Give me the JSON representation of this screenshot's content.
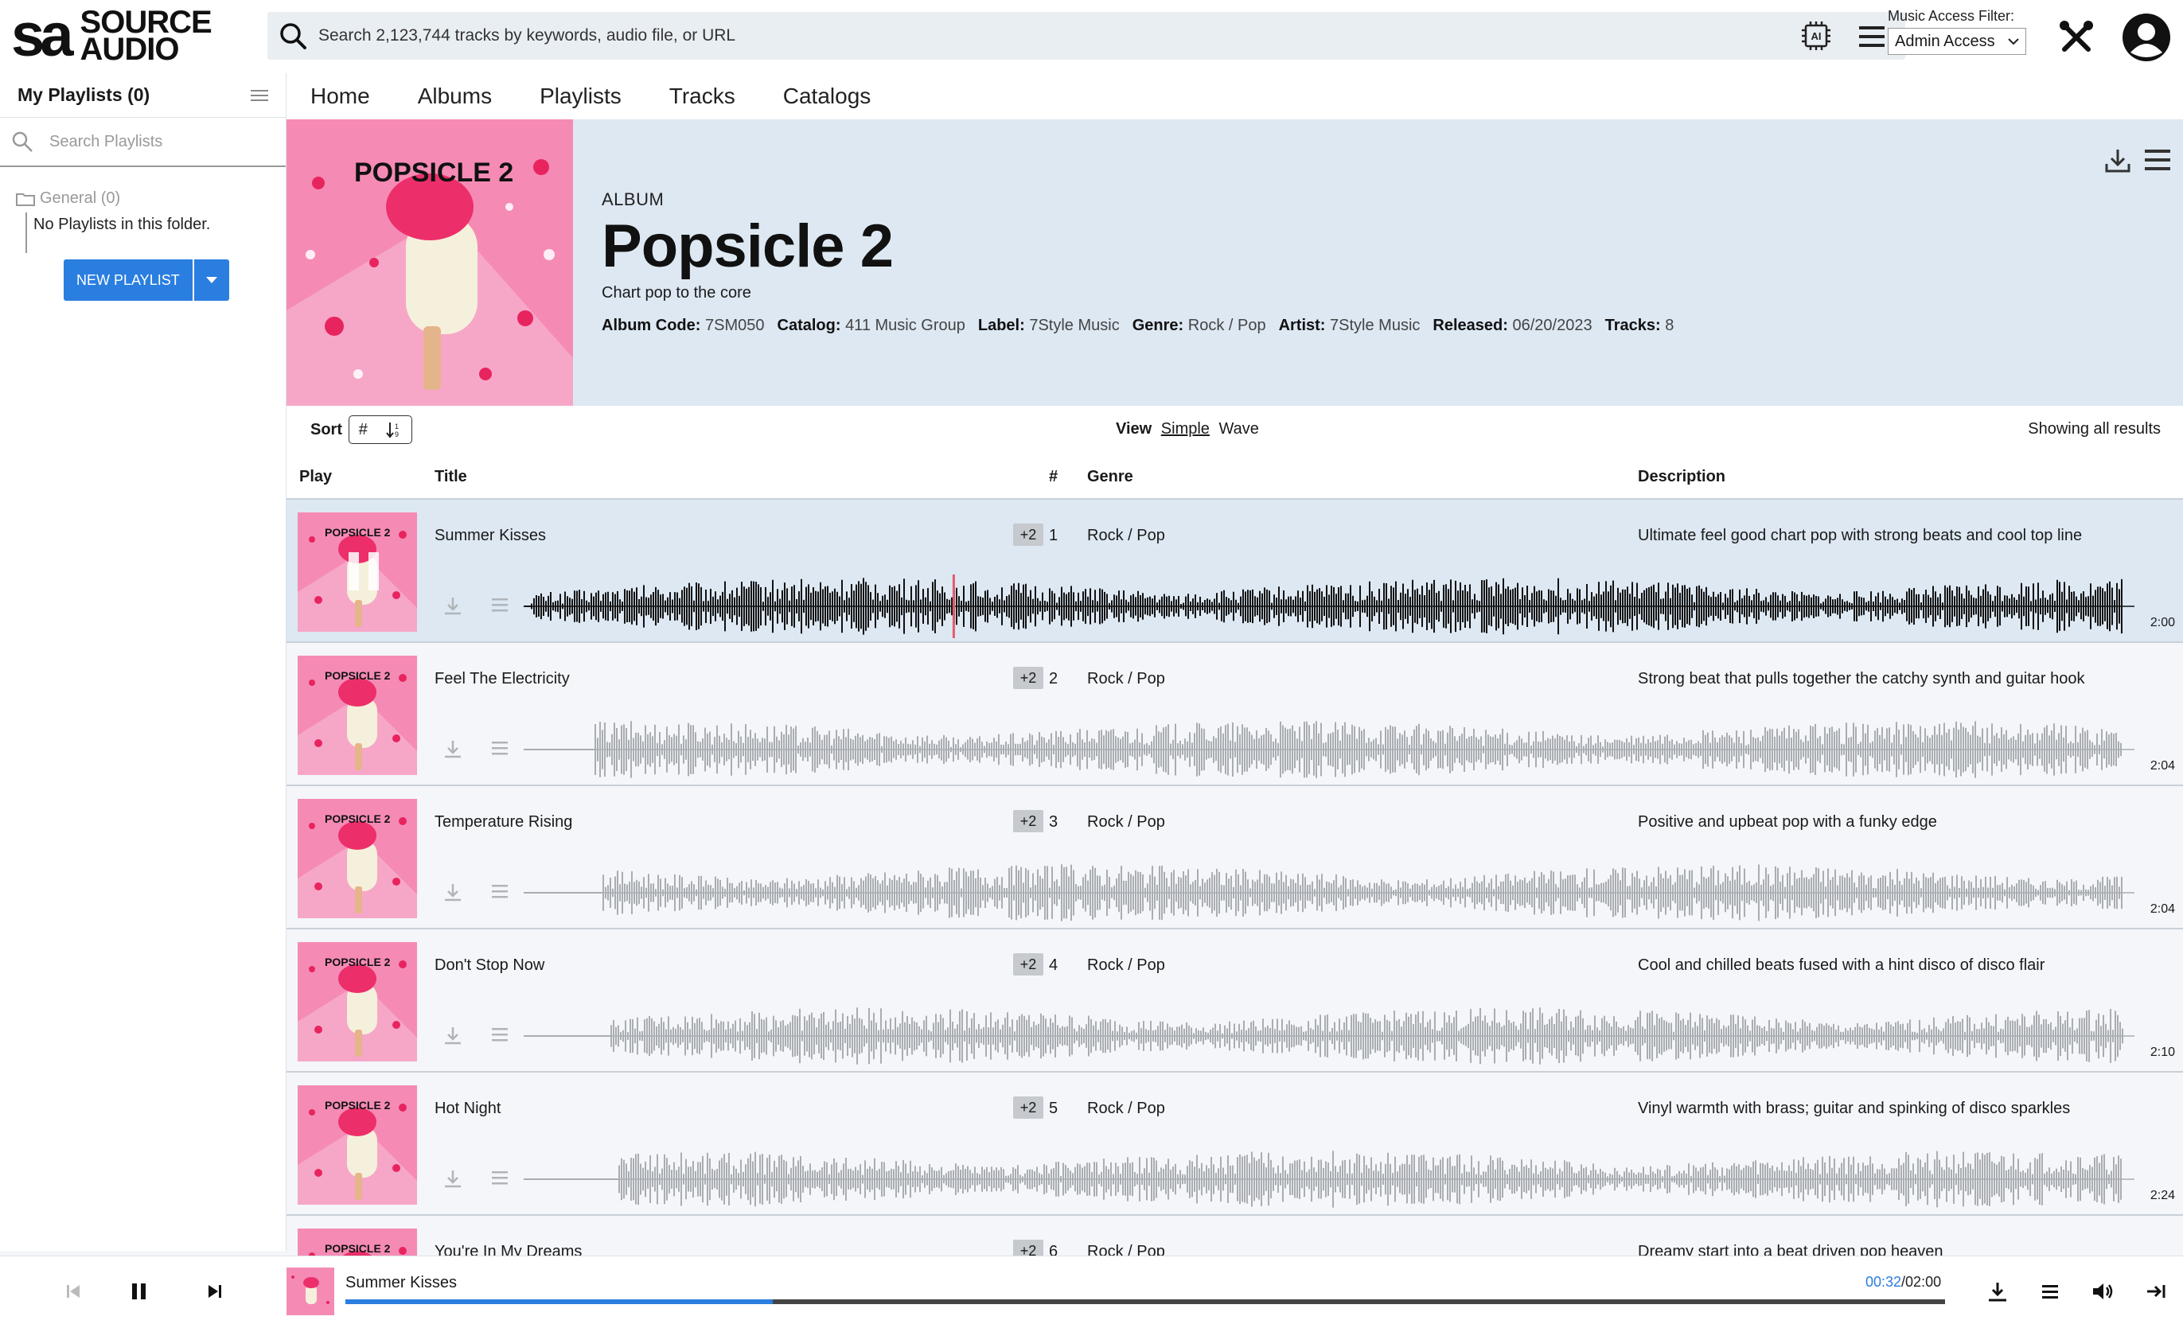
{
  "logo": {
    "mark": "sa",
    "line1": "SOURCE",
    "line2": "AUDIO"
  },
  "search": {
    "placeholder": "Search 2,123,744 tracks by keywords, audio file, or URL"
  },
  "access_filter": {
    "label": "Music Access Filter:",
    "value": "Admin Access"
  },
  "sidebar": {
    "title": "My Playlists (0)",
    "search_placeholder": "Search Playlists",
    "folder_name": "General (0)",
    "empty_text": "No Playlists in this folder.",
    "new_playlist_label": "NEW PLAYLIST"
  },
  "nav": {
    "items": [
      "Home",
      "Albums",
      "Playlists",
      "Tracks",
      "Catalogs"
    ]
  },
  "album": {
    "kicker": "ALBUM",
    "title": "Popsicle 2",
    "subtitle": "Chart pop to the core",
    "cover_text": "POPSICLE 2",
    "meta": [
      {
        "label": "Album Code:",
        "value": "7SM050"
      },
      {
        "label": "Catalog:",
        "value": "411 Music Group"
      },
      {
        "label": "Label:",
        "value": "7Style Music"
      },
      {
        "label": "Genre:",
        "value": "Rock / Pop"
      },
      {
        "label": "Artist:",
        "value": "7Style Music"
      },
      {
        "label": "Released:",
        "value": "06/20/2023"
      },
      {
        "label": "Tracks:",
        "value": "8"
      }
    ]
  },
  "sortbar": {
    "sort_label": "Sort",
    "sort_key": "#",
    "view_label": "View",
    "view_simple": "Simple",
    "view_wave": "Wave",
    "showing": "Showing all results"
  },
  "table": {
    "headers": {
      "play": "Play",
      "title": "Title",
      "num": "#",
      "genre": "Genre",
      "description": "Description"
    },
    "rows": [
      {
        "title": "Summer Kisses",
        "alt": "+2",
        "num": "1",
        "genre": "Rock / Pop",
        "description": "Ultimate feel good chart pop with strong beats and cool top line",
        "duration": "2:00",
        "active": true
      },
      {
        "title": "Feel The Electricity",
        "alt": "+2",
        "num": "2",
        "genre": "Rock / Pop",
        "description": "Strong beat that pulls together the catchy synth and guitar hook",
        "duration": "2:04",
        "active": false
      },
      {
        "title": "Temperature Rising",
        "alt": "+2",
        "num": "3",
        "genre": "Rock / Pop",
        "description": "Positive and upbeat pop with a funky edge",
        "duration": "2:04",
        "active": false
      },
      {
        "title": "Don't Stop Now",
        "alt": "+2",
        "num": "4",
        "genre": "Rock / Pop",
        "description": "Cool and chilled beats fused with a hint disco of disco flair",
        "duration": "2:10",
        "active": false
      },
      {
        "title": "Hot Night",
        "alt": "+2",
        "num": "5",
        "genre": "Rock / Pop",
        "description": "Vinyl warmth with brass; guitar and spinking of disco sparkles",
        "duration": "2:24",
        "active": false
      },
      {
        "title": "You're In My Dreams",
        "alt": "+2",
        "num": "6",
        "genre": "Rock / Pop",
        "description": "Dreamy start into a beat driven pop heaven",
        "duration": "",
        "active": false
      }
    ]
  },
  "player": {
    "title": "Summer Kisses",
    "current_time": "00:32",
    "total_time": "/02:00",
    "progress": 0.267
  },
  "colors": {
    "accent": "#2a7ee0",
    "header_bg": "#dde8f2",
    "cover_pink": "#f26aa0"
  }
}
